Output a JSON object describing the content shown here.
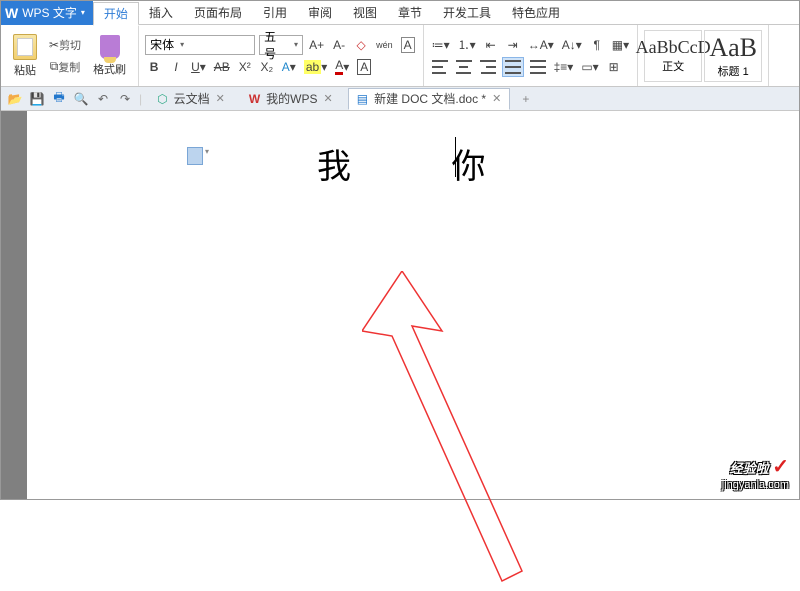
{
  "app": {
    "name": "WPS 文字",
    "dropdown": "▾"
  },
  "menu": {
    "items": [
      {
        "label": "开始",
        "active": true
      },
      {
        "label": "插入"
      },
      {
        "label": "页面布局"
      },
      {
        "label": "引用"
      },
      {
        "label": "审阅"
      },
      {
        "label": "视图"
      },
      {
        "label": "章节"
      },
      {
        "label": "开发工具"
      },
      {
        "label": "特色应用"
      }
    ]
  },
  "ribbon": {
    "paste": "粘贴",
    "cut": "剪切",
    "copy": "复制",
    "format_painter": "格式刷",
    "font_name": "宋体",
    "font_size": "五号",
    "a_plus": "A+",
    "a_minus": "A-",
    "clear_fmt": "A",
    "pinyin": "wén",
    "bold": "B",
    "italic": "I",
    "underline": "U",
    "strike": "AB",
    "super": "X²",
    "sub": "X₂",
    "font_color": "A",
    "highlight": "A",
    "char_border": "A",
    "styles": {
      "normal_preview": "AaBbCcD",
      "normal_label": "正文",
      "h1_preview": "AaB",
      "h1_label": "标题 1"
    }
  },
  "qat": {
    "tabs": [
      {
        "label": "云文档",
        "icon": "cloud",
        "closable": true
      },
      {
        "label": "我的WPS",
        "icon": "wps",
        "closable": true
      },
      {
        "label": "新建 DOC 文档.doc *",
        "icon": "doc",
        "closable": true,
        "active": true
      }
    ],
    "plus": "+"
  },
  "document": {
    "text": "我  你"
  },
  "watermark": {
    "line1": "经验啦",
    "check": "✓",
    "line2": "jingyanla.com"
  }
}
